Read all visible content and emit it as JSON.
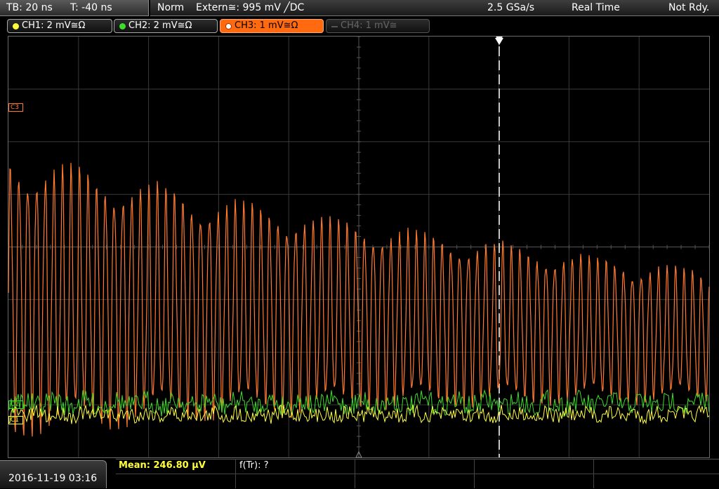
{
  "timebase": {
    "tb": "TB: 20 ns",
    "trigger_time": "T: -40 ns"
  },
  "status": {
    "mode": "Norm",
    "trigger_source": "Extern≅: 995 mV ╱DC",
    "sample_rate": "2.5 GSa/s",
    "acq_mode": "Real Time",
    "state": "Not Rdy."
  },
  "channels": [
    {
      "label": "CH1: 2 mV≅Ω",
      "color": "#ffff3c",
      "active": true
    },
    {
      "label": "CH2: 2 mV≅Ω",
      "color": "#3ddc29",
      "active": true
    },
    {
      "label": "CH3: 1 mV≅Ω",
      "color": "#ff6a10",
      "active": true,
      "selected": true
    },
    {
      "label": "CH4: 1 mV≅",
      "color": "#666666",
      "active": false
    }
  ],
  "markers": {
    "c3": "C3",
    "c2": "C2",
    "c1": "C1"
  },
  "trigger_marker": "T",
  "bottom": {
    "datetime": "2016-11-19 03:16",
    "mean": "Mean: 246.80 µV",
    "f_tr": "f(Tr): ?"
  },
  "colors": {
    "ch1": "#ffff3c",
    "ch2": "#3ddc29",
    "ch3": "#ff7a2c",
    "grid": "#3a3a3a"
  }
}
